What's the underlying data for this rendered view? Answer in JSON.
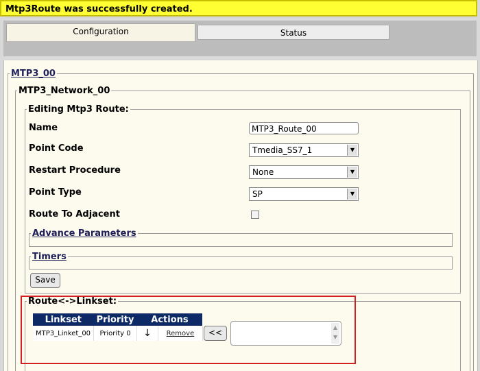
{
  "banner": {
    "message": "Mtp3Route was successfully created."
  },
  "tabs": [
    {
      "label": "Configuration",
      "active": true
    },
    {
      "label": "Status",
      "active": false
    }
  ],
  "fieldsets": {
    "outer": "MTP3_00",
    "network": "MTP3_Network_00",
    "editing": "Editing Mtp3 Route:",
    "advance": "Advance Parameters",
    "timers": "Timers",
    "route_linkset": "Route<->Linkset:"
  },
  "form": {
    "name": {
      "label": "Name",
      "value": "MTP3_Route_00"
    },
    "point_code": {
      "label": "Point Code",
      "value": "Tmedia_SS7_1"
    },
    "restart_procedure": {
      "label": "Restart Procedure",
      "value": "None"
    },
    "point_type": {
      "label": "Point Type",
      "value": "SP"
    },
    "route_to_adjacent": {
      "label": "Route To Adjacent",
      "checked": false
    },
    "save_label": "Save"
  },
  "linkset_table": {
    "headers": [
      "Linkset",
      "Priority",
      "Actions"
    ],
    "rows": [
      {
        "linkset": "MTP3_Linket_00",
        "priority": "Priority 0",
        "action_icon": "↓",
        "remove": "Remove"
      }
    ]
  },
  "move_button_label": "<<"
}
